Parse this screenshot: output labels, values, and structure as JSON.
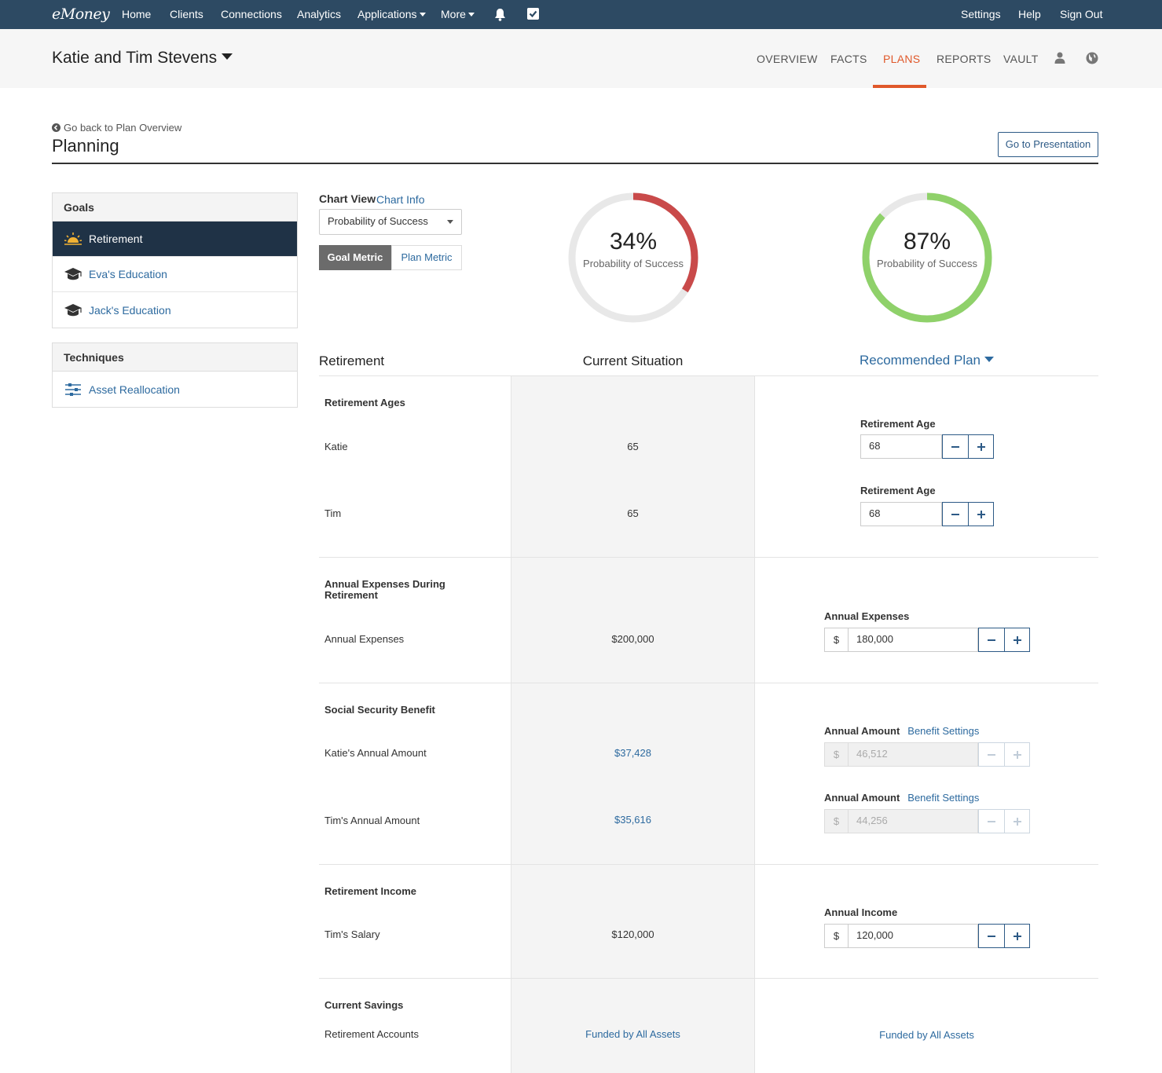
{
  "topnav": {
    "logo": "eMoney",
    "items": [
      "Home",
      "Clients",
      "Connections",
      "Analytics",
      "Applications",
      "More"
    ],
    "right": [
      "Settings",
      "Help",
      "Sign Out"
    ],
    "icons": [
      "bell-icon",
      "checkbox-icon"
    ]
  },
  "client": {
    "name": "Katie and Tim Stevens",
    "tabs": [
      "OVERVIEW",
      "FACTS",
      "PLANS",
      "REPORTS",
      "VAULT"
    ],
    "active_tab": "PLANS",
    "accent": "#e0582a"
  },
  "page": {
    "back_link": "Go back to Plan Overview",
    "title": "Planning",
    "presentation_button": "Go to Presentation"
  },
  "sidebar": {
    "goals_heading": "Goals",
    "goals": [
      {
        "label": "Retirement",
        "icon": "sunrise-icon",
        "active": true
      },
      {
        "label": "Eva's Education",
        "icon": "graduation-cap-icon",
        "active": false
      },
      {
        "label": "Jack's Education",
        "icon": "graduation-cap-icon",
        "active": false
      }
    ],
    "techniques_heading": "Techniques",
    "techniques": [
      {
        "label": "Asset Reallocation",
        "icon": "sliders-icon"
      }
    ]
  },
  "chart_view": {
    "label": "Chart View",
    "info_link": "Chart Info",
    "selected": "Probability of Success",
    "toggle": [
      "Goal Metric",
      "Plan Metric"
    ],
    "active_toggle": "Goal Metric"
  },
  "gauges": {
    "current": {
      "percent": "34%",
      "value": 0.34,
      "label": "Probability of Success",
      "color": "#c94a4a"
    },
    "recommended": {
      "percent": "87%",
      "value": 0.87,
      "label": "Probability of Success",
      "color": "#8fd16a"
    }
  },
  "columns": {
    "section": "Retirement",
    "current": "Current Situation",
    "recommended": "Recommended Plan"
  },
  "sections": {
    "ages": {
      "title": "Retirement Ages",
      "rows": [
        {
          "label": "Katie",
          "current": "65",
          "control_label": "Retirement Age",
          "value": "68"
        },
        {
          "label": "Tim",
          "current": "65",
          "control_label": "Retirement Age",
          "value": "68"
        }
      ]
    },
    "expenses": {
      "title": "Annual Expenses During Retirement",
      "row": {
        "label": "Annual Expenses",
        "current": "$200,000",
        "control_label": "Annual Expenses",
        "prefix": "$",
        "value": "180,000"
      }
    },
    "social_security": {
      "title": "Social Security Benefit",
      "rows": [
        {
          "label": "Katie's Annual Amount",
          "current": "$37,428",
          "control_label": "Annual Amount",
          "link": "Benefit Settings",
          "prefix": "$",
          "value": "46,512"
        },
        {
          "label": "Tim's Annual Amount",
          "current": "$35,616",
          "control_label": "Annual Amount",
          "link": "Benefit Settings",
          "prefix": "$",
          "value": "44,256"
        }
      ]
    },
    "income": {
      "title": "Retirement Income",
      "row": {
        "label": "Tim's Salary",
        "current": "$120,000",
        "control_label": "Annual Income",
        "prefix": "$",
        "value": "120,000"
      }
    },
    "savings": {
      "title": "Current Savings",
      "row": {
        "label": "Retirement Accounts",
        "current": "Funded by All Assets",
        "recommended": "Funded by All Assets"
      }
    }
  }
}
